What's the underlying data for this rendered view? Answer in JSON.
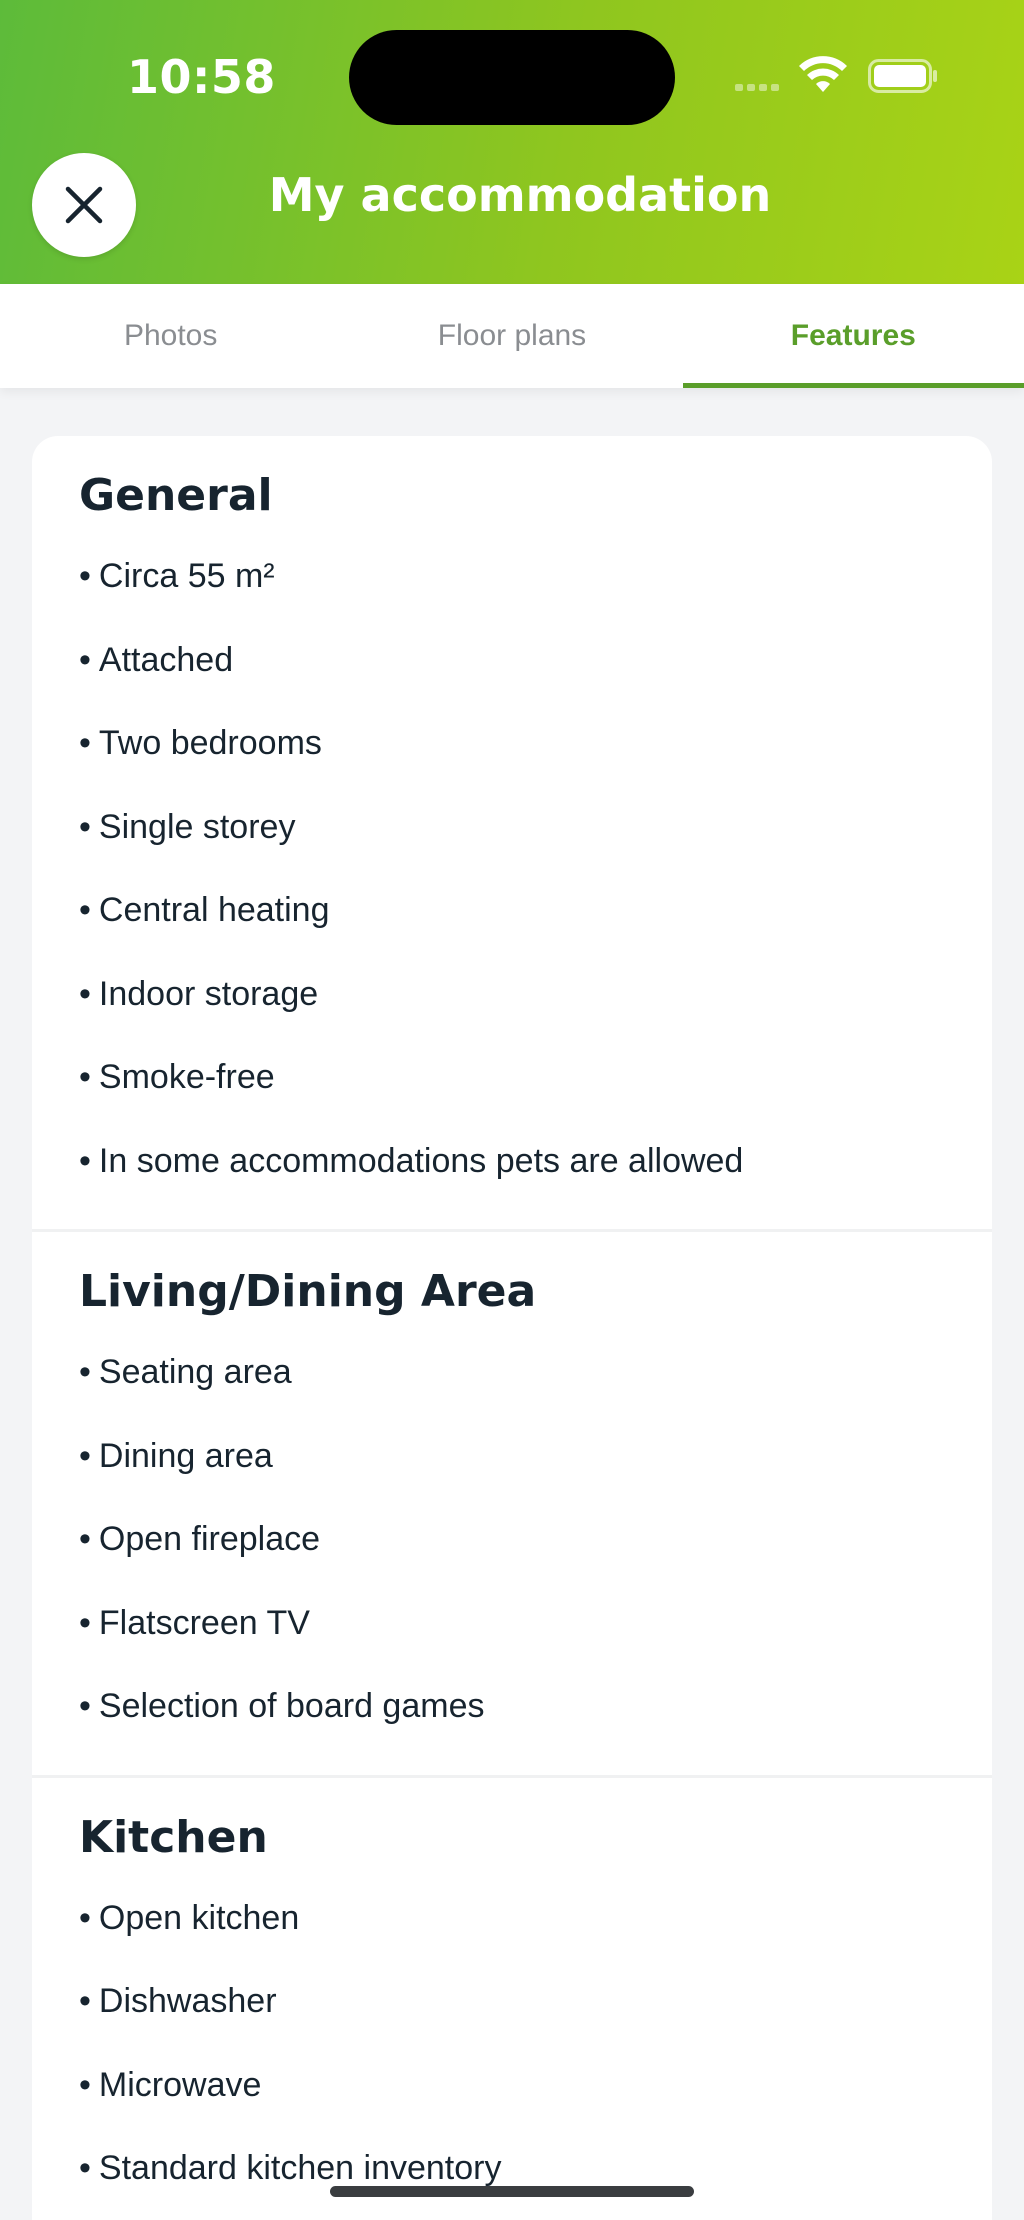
{
  "status_bar": {
    "time": "10:58"
  },
  "header": {
    "title": "My accommodation",
    "close_label": "Close"
  },
  "tabs": [
    {
      "label": "Photos",
      "active": false
    },
    {
      "label": "Floor plans",
      "active": false
    },
    {
      "label": "Features",
      "active": true
    }
  ],
  "sections": [
    {
      "heading": "General",
      "items": [
        "Circa 55 m²",
        "Attached",
        "Two bedrooms",
        "Single storey",
        "Central heating",
        "Indoor storage",
        "Smoke-free",
        "In some accommodations pets are allowed"
      ]
    },
    {
      "heading": "Living/Dining Area",
      "items": [
        "Seating area",
        "Dining area",
        "Open fireplace",
        "Flatscreen TV",
        "Selection of board games"
      ]
    },
    {
      "heading": "Kitchen",
      "items": [
        "Open kitchen",
        "Dishwasher",
        "Microwave",
        "Standard kitchen inventory"
      ]
    }
  ],
  "colors": {
    "accent": "#5a9e2a",
    "header_start": "#5dbb3a",
    "header_end": "#a9d316",
    "text": "#17242f"
  }
}
